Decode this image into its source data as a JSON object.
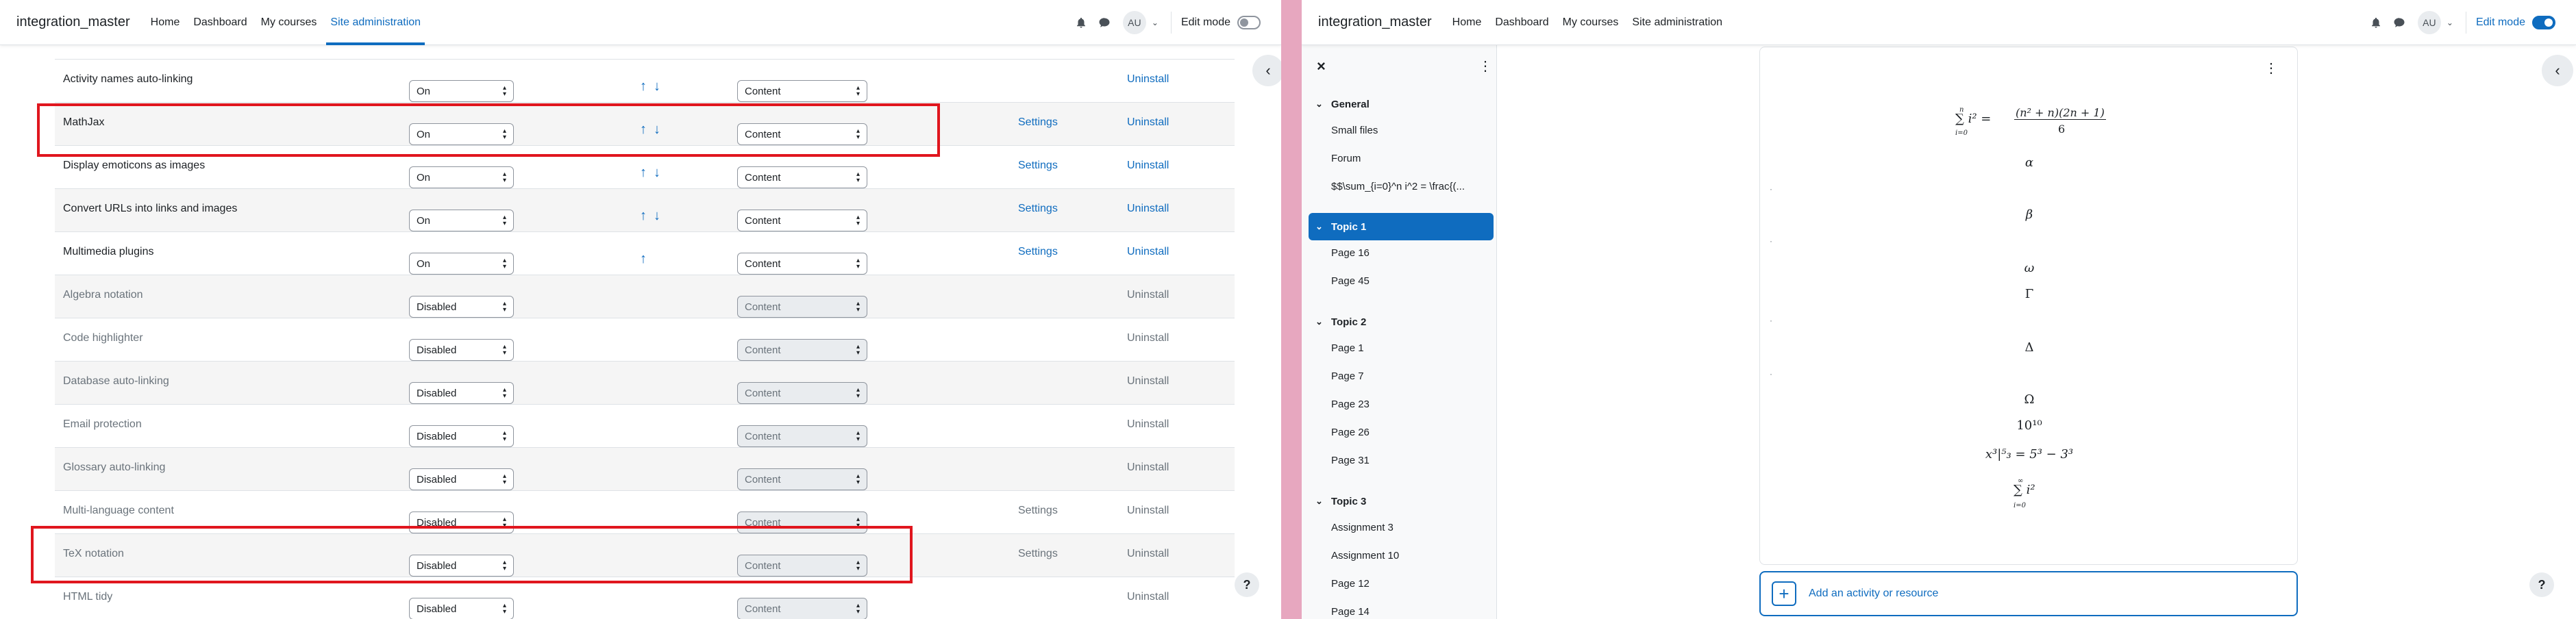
{
  "left": {
    "navbar": {
      "brand": "integration_master",
      "links": [
        "Home",
        "Dashboard",
        "My courses",
        "Site administration"
      ],
      "active_link": "Site administration",
      "avatar": "AU",
      "edit_mode_label": "Edit mode",
      "edit_mode_on": false
    },
    "rows": [
      {
        "name": "Activity names auto-linking",
        "state": "On",
        "apply": "Content",
        "arrows": "↑↓",
        "settings": "",
        "uninstall": "Uninstall",
        "enabled": true
      },
      {
        "name": "MathJax",
        "state": "On",
        "apply": "Content",
        "arrows": "↑↓",
        "settings": "Settings",
        "uninstall": "Uninstall",
        "enabled": true
      },
      {
        "name": "Display emoticons as images",
        "state": "On",
        "apply": "Content",
        "arrows": "↑↓",
        "settings": "Settings",
        "uninstall": "Uninstall",
        "enabled": true
      },
      {
        "name": "Convert URLs into links and images",
        "state": "On",
        "apply": "Content",
        "arrows": "↑↓",
        "settings": "Settings",
        "uninstall": "Uninstall",
        "enabled": true
      },
      {
        "name": "Multimedia plugins",
        "state": "On",
        "apply": "Content",
        "arrows": "↑",
        "settings": "Settings",
        "uninstall": "Uninstall",
        "enabled": true
      },
      {
        "name": "Algebra notation",
        "state": "Disabled",
        "apply": "Content",
        "arrows": "",
        "settings": "",
        "uninstall": "Uninstall",
        "enabled": false
      },
      {
        "name": "Code highlighter",
        "state": "Disabled",
        "apply": "Content",
        "arrows": "",
        "settings": "",
        "uninstall": "Uninstall",
        "enabled": false
      },
      {
        "name": "Database auto-linking",
        "state": "Disabled",
        "apply": "Content",
        "arrows": "",
        "settings": "",
        "uninstall": "Uninstall",
        "enabled": false
      },
      {
        "name": "Email protection",
        "state": "Disabled",
        "apply": "Content",
        "arrows": "",
        "settings": "",
        "uninstall": "Uninstall",
        "enabled": false
      },
      {
        "name": "Glossary auto-linking",
        "state": "Disabled",
        "apply": "Content",
        "arrows": "",
        "settings": "",
        "uninstall": "Uninstall",
        "enabled": false
      },
      {
        "name": "Multi-language content",
        "state": "Disabled",
        "apply": "Content",
        "arrows": "",
        "settings": "Settings",
        "uninstall": "Uninstall",
        "enabled": false
      },
      {
        "name": "TeX notation",
        "state": "Disabled",
        "apply": "Content",
        "arrows": "",
        "settings": "Settings",
        "uninstall": "Uninstall",
        "enabled": false
      },
      {
        "name": "HTML tidy",
        "state": "Disabled",
        "apply": "Content",
        "arrows": "",
        "settings": "",
        "uninstall": "Uninstall",
        "enabled": false
      }
    ],
    "help_label": "?"
  },
  "right": {
    "navbar": {
      "brand": "integration_master",
      "links": [
        "Home",
        "Dashboard",
        "My courses",
        "Site administration"
      ],
      "avatar": "AU",
      "edit_mode_label": "Edit mode",
      "edit_mode_on": true
    },
    "course_index": {
      "sections": [
        {
          "title": "General",
          "current": false,
          "items": [
            "Small files",
            "Forum",
            "$$\\sum_{i=0}^n i^2 = \\frac{(..."
          ]
        },
        {
          "title": "Topic 1",
          "current": true,
          "items": [
            "Page 16",
            "Page 45"
          ]
        },
        {
          "title": "Topic 2",
          "current": false,
          "items": [
            "Page 1",
            "Page 7",
            "Page 23",
            "Page 26",
            "Page 31"
          ]
        },
        {
          "title": "Topic 3",
          "current": false,
          "items": [
            "Assignment 3",
            "Assignment 10",
            "Page 12",
            "Page 14"
          ]
        }
      ]
    },
    "math_lines": [
      "α",
      "β",
      "ω",
      "Γ",
      "Δ",
      "Ω"
    ],
    "math_formula": {
      "lhs": "∑ i² =",
      "numerator": "(n² + n)(2n + 1)",
      "denominator": "6",
      "sum_top": "n",
      "sum_bottom": "i=0"
    },
    "math_power": "10¹⁰",
    "math_eval": "x³|⁵₃ = 5³ − 3³",
    "math_sum_inf": {
      "body": "∑ i²",
      "top": "∞",
      "bottom": "i=0"
    },
    "add_activity_label": "Add an activity or resource",
    "help_label": "?"
  }
}
